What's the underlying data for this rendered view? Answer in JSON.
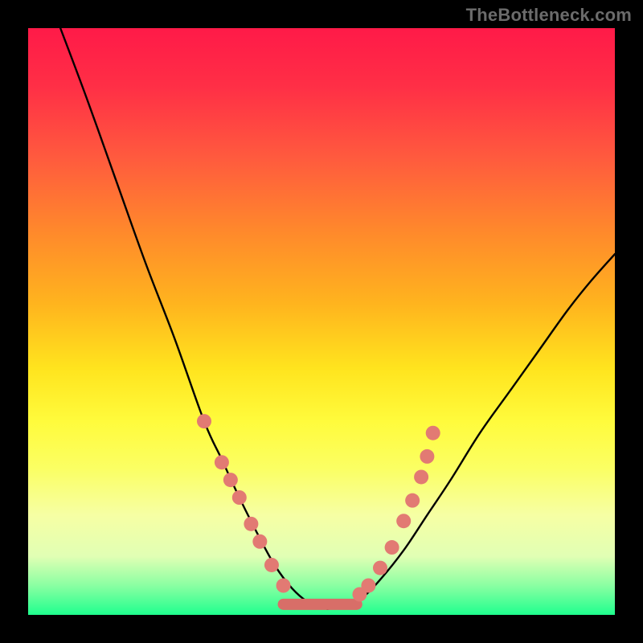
{
  "watermark": "TheBottleneck.com",
  "chart_data": {
    "type": "line",
    "title": "",
    "xlabel": "",
    "ylabel": "",
    "xlim": [
      0,
      1
    ],
    "ylim": [
      0,
      1
    ],
    "curve_left": [
      {
        "x": 0.055,
        "y": 1.0
      },
      {
        "x": 0.1,
        "y": 0.88
      },
      {
        "x": 0.15,
        "y": 0.74
      },
      {
        "x": 0.2,
        "y": 0.6
      },
      {
        "x": 0.25,
        "y": 0.47
      },
      {
        "x": 0.3,
        "y": 0.33
      },
      {
        "x": 0.33,
        "y": 0.265
      },
      {
        "x": 0.36,
        "y": 0.2
      },
      {
        "x": 0.39,
        "y": 0.14
      },
      {
        "x": 0.42,
        "y": 0.085
      },
      {
        "x": 0.45,
        "y": 0.045
      },
      {
        "x": 0.48,
        "y": 0.02
      },
      {
        "x": 0.51,
        "y": 0.01
      }
    ],
    "curve_right": [
      {
        "x": 0.51,
        "y": 0.01
      },
      {
        "x": 0.54,
        "y": 0.015
      },
      {
        "x": 0.57,
        "y": 0.03
      },
      {
        "x": 0.6,
        "y": 0.06
      },
      {
        "x": 0.64,
        "y": 0.11
      },
      {
        "x": 0.68,
        "y": 0.17
      },
      {
        "x": 0.72,
        "y": 0.23
      },
      {
        "x": 0.77,
        "y": 0.31
      },
      {
        "x": 0.82,
        "y": 0.38
      },
      {
        "x": 0.87,
        "y": 0.45
      },
      {
        "x": 0.92,
        "y": 0.52
      },
      {
        "x": 0.96,
        "y": 0.57
      },
      {
        "x": 1.0,
        "y": 0.615
      }
    ],
    "flat_bottom": [
      {
        "x": 0.435,
        "y": 0.018
      },
      {
        "x": 0.56,
        "y": 0.018
      }
    ],
    "dots_left": [
      {
        "x": 0.3,
        "y": 0.33
      },
      {
        "x": 0.33,
        "y": 0.26
      },
      {
        "x": 0.345,
        "y": 0.23
      },
      {
        "x": 0.36,
        "y": 0.2
      },
      {
        "x": 0.38,
        "y": 0.155
      },
      {
        "x": 0.395,
        "y": 0.125
      },
      {
        "x": 0.415,
        "y": 0.085
      },
      {
        "x": 0.435,
        "y": 0.05
      }
    ],
    "dots_right": [
      {
        "x": 0.565,
        "y": 0.035
      },
      {
        "x": 0.58,
        "y": 0.05
      },
      {
        "x": 0.6,
        "y": 0.08
      },
      {
        "x": 0.62,
        "y": 0.115
      },
      {
        "x": 0.64,
        "y": 0.16
      },
      {
        "x": 0.655,
        "y": 0.195
      },
      {
        "x": 0.67,
        "y": 0.235
      },
      {
        "x": 0.68,
        "y": 0.27
      },
      {
        "x": 0.69,
        "y": 0.31
      }
    ],
    "colors": {
      "curve": "#000000",
      "dot_fill": "#e27a73",
      "bottom_stroke": "#d86e68"
    }
  }
}
